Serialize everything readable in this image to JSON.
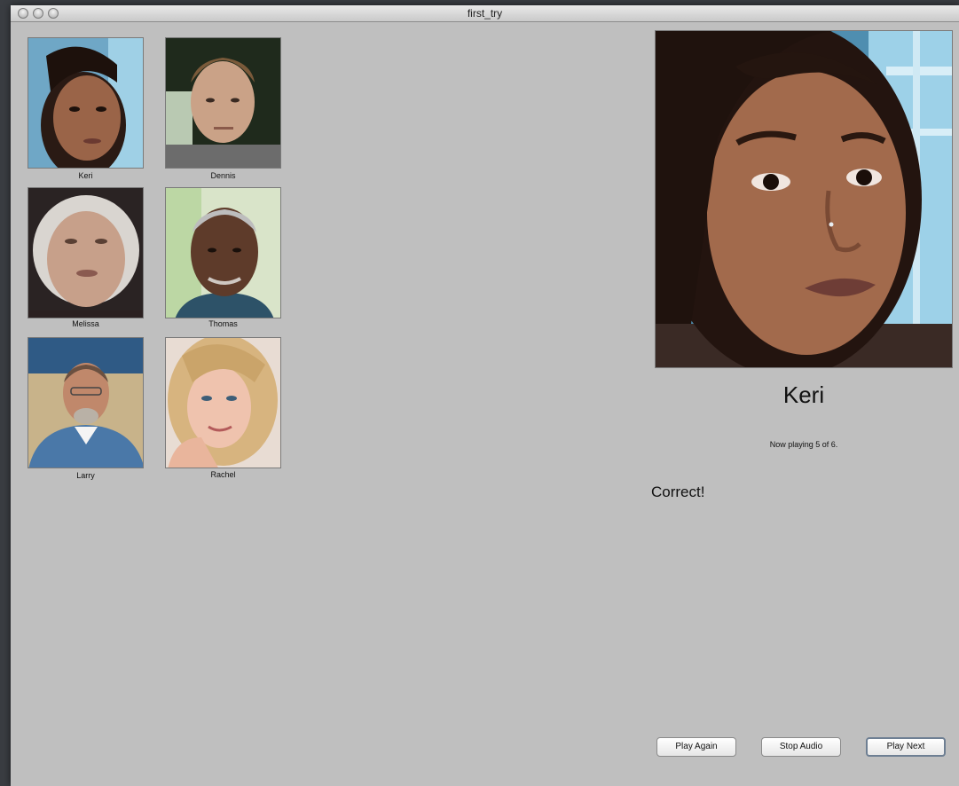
{
  "window": {
    "title": "first_try"
  },
  "gallery": [
    {
      "name": "Keri"
    },
    {
      "name": "Dennis"
    },
    {
      "name": "Melissa"
    },
    {
      "name": "Thomas"
    },
    {
      "name": "Larry"
    },
    {
      "name": "Rachel"
    }
  ],
  "current": {
    "name": "Keri",
    "status": "Now playing 5 of 6.",
    "feedback": "Correct!"
  },
  "controls": {
    "play_again": "Play Again",
    "stop_audio": "Stop Audio",
    "play_next": "Play Next"
  },
  "colors": {
    "window_bg": "#bfbfbf",
    "desktop_bg": "#3a3d42"
  }
}
